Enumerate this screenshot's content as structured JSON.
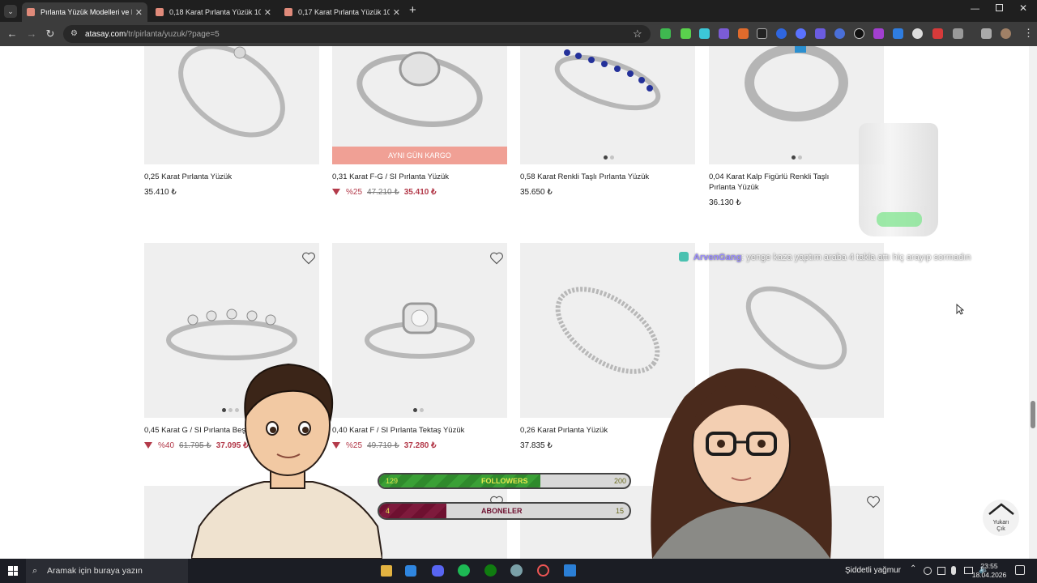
{
  "tabs": [
    {
      "title": "Pırlanta Yüzük Modelleri ve Fiyatl"
    },
    {
      "title": "0,18 Karat Pırlanta Yüzük 10013"
    },
    {
      "title": "0,17 Karat Pırlanta Yüzük 10012"
    }
  ],
  "address": {
    "host": "atasay.com",
    "path": "/tr/pirlanta/yuzuk/?page=5"
  },
  "products": [
    {
      "name": "0,25 Karat Pırlanta Yüzük",
      "price": "35.410 ₺"
    },
    {
      "name": "0,31 Karat F-G / SI Pırlanta Yüzük",
      "badge": "AYNI GÜN KARGO",
      "discount": "%25",
      "old_price": "47.210 ₺",
      "price": "35.410 ₺"
    },
    {
      "name": "0,58 Karat Renkli Taşlı Pırlanta Yüzük",
      "price": "35.650 ₺"
    },
    {
      "name": "0,04 Karat Kalp Figürlü Renkli Taşlı Pırlanta Yüzük",
      "price": "36.130 ₺"
    },
    {
      "name": "0,45 Karat G / SI Pırlanta Beştaş",
      "discount": "%40",
      "old_price": "61.795 ₺",
      "price": "37.095 ₺"
    },
    {
      "name": "0,40 Karat F / SI Pırlanta Tektaş Yüzük",
      "discount": "%25",
      "old_price": "49.710 ₺",
      "price": "37.280 ₺"
    },
    {
      "name": "0,26 Karat Pırlanta Yüzük",
      "price": "37.835 ₺"
    }
  ],
  "chat": {
    "user": "ArvenGang",
    "message": ": yenge kaza yaptım araba 4 takla attı hiç arayıp sormadın"
  },
  "followers": {
    "label": "FOLLOWERS",
    "current": "129",
    "goal": "200",
    "progress": 0.645
  },
  "subs": {
    "label": "ABONELER",
    "current": "4",
    "goal": "15",
    "progress": 0.267
  },
  "back_to_top": {
    "line1": "Yukarı",
    "line2": "Çık"
  },
  "taskbar": {
    "search_placeholder": "Aramak için buraya yazın",
    "weather": "Şiddetli yağmur",
    "time": "23:55",
    "date": "18.04.2026"
  },
  "colors": {
    "accent_red": "#b33a4a",
    "badge_pink": "#f0a095",
    "followers_green": "#2f8a2c",
    "subs_maroon": "#6e1030",
    "chat_purple": "#9a8cff"
  }
}
